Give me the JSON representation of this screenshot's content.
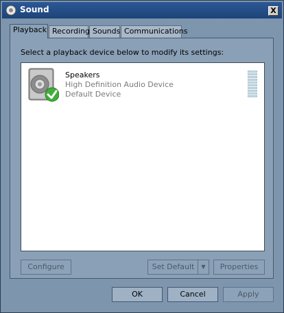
{
  "window": {
    "title": "Sound",
    "close_label": "X"
  },
  "tabs": [
    {
      "label": "Playback"
    },
    {
      "label": "Recording"
    },
    {
      "label": "Sounds"
    },
    {
      "label": "Communications"
    }
  ],
  "active_tab": "Playback",
  "panel": {
    "prompt": "Select a playback device below to modify its settings:"
  },
  "devices": [
    {
      "name": "Speakers",
      "driver": "High Definition Audio Device",
      "status": "Default Device",
      "icon": "speaker-icon",
      "badge": "default-check-icon"
    }
  ],
  "panel_buttons": {
    "configure": "Configure",
    "set_default": "Set Default",
    "properties": "Properties"
  },
  "dialog_buttons": {
    "ok": "OK",
    "cancel": "Cancel",
    "apply": "Apply"
  },
  "colors": {
    "titlebar": "#2c5896",
    "window": "#7d95ad",
    "panel": "#8aa0b6",
    "list": "#ffffff",
    "check": "#3fae3a"
  }
}
